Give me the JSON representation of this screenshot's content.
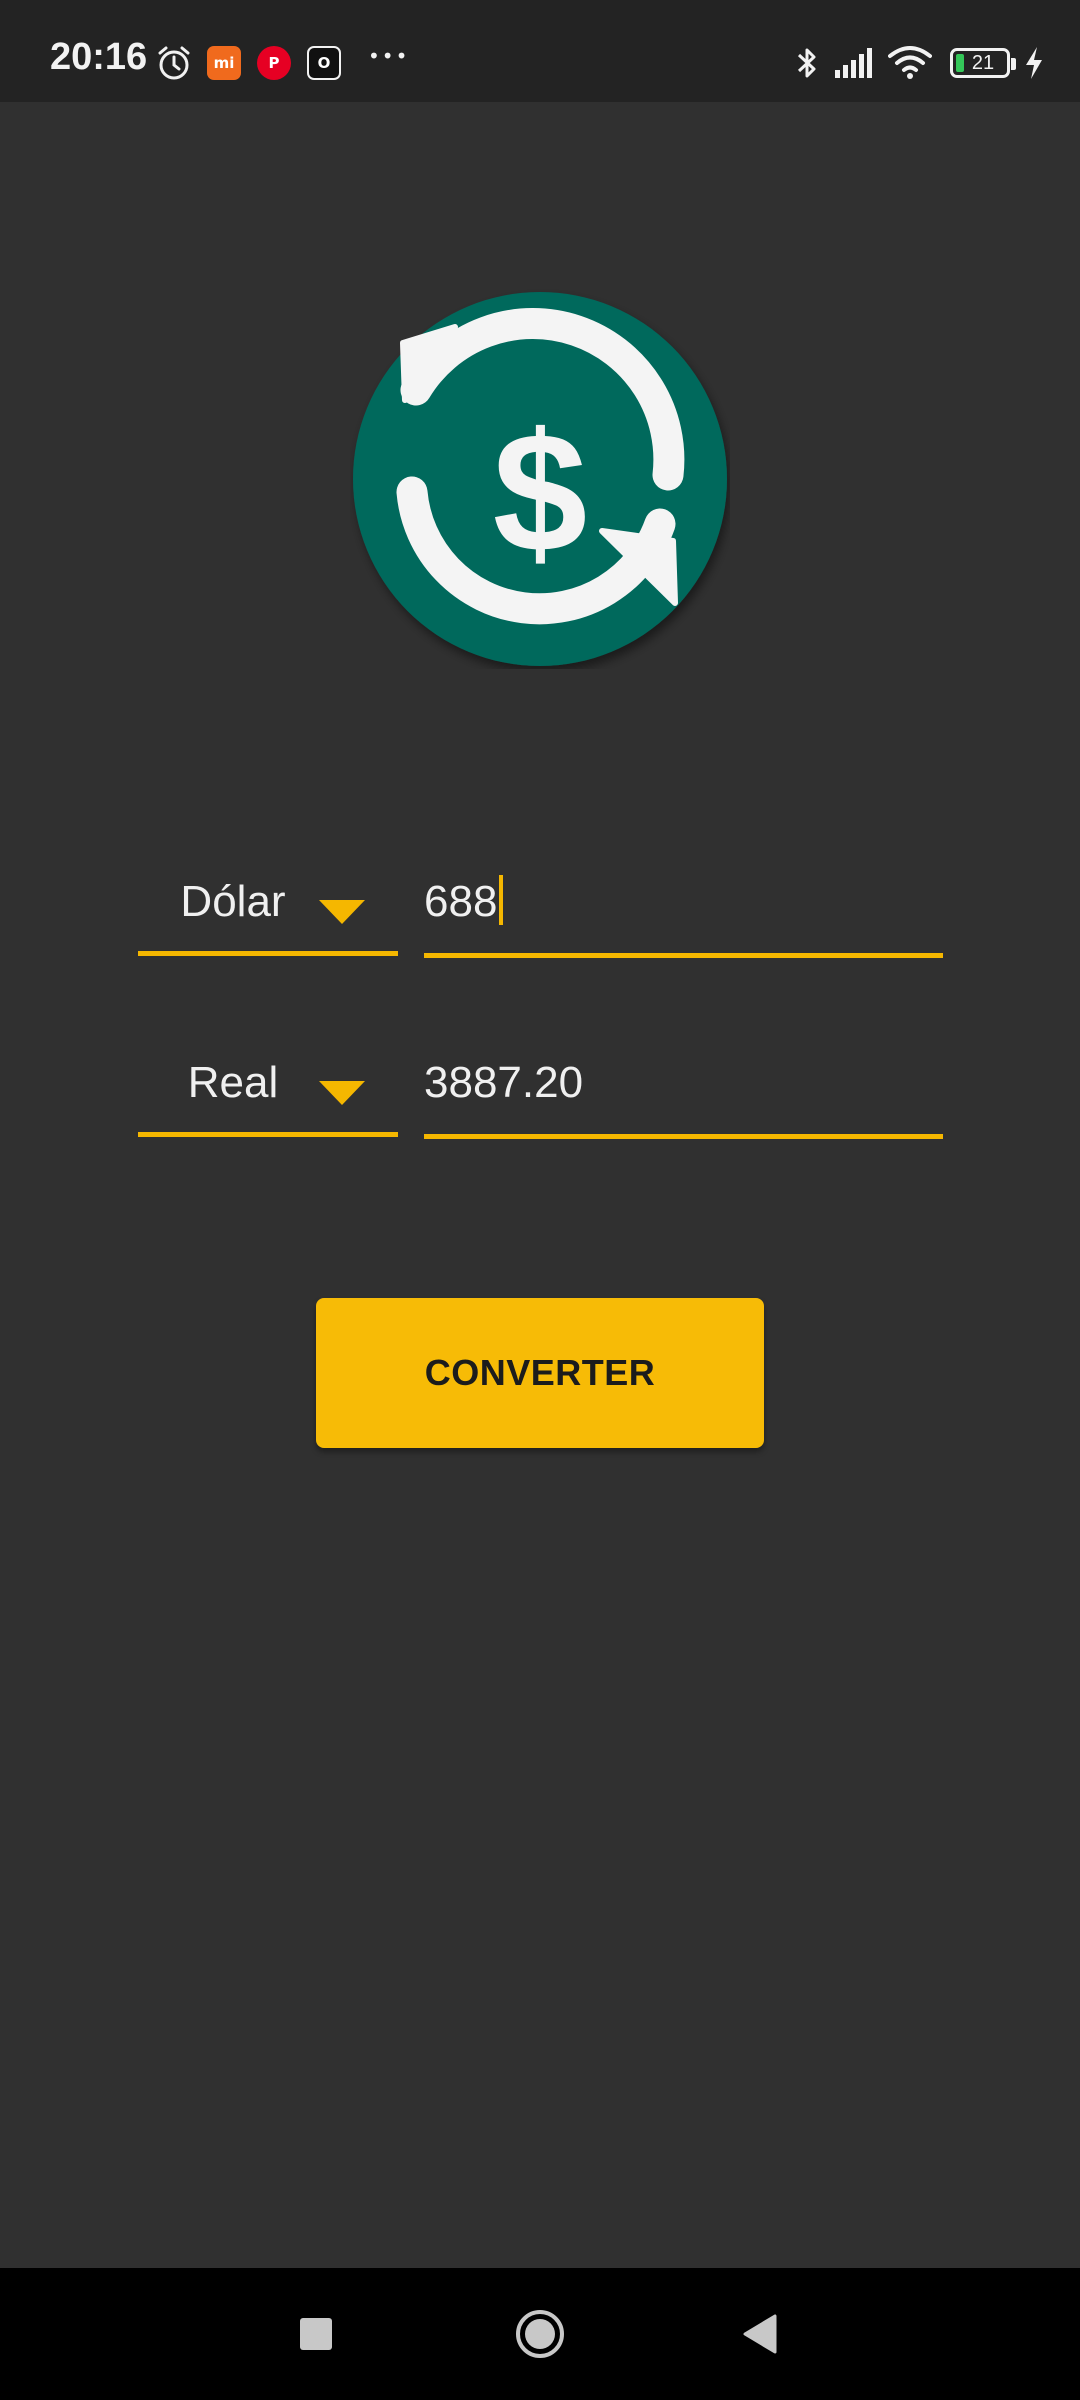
{
  "status_bar": {
    "time": "20:16",
    "battery_level": "21",
    "notification_apps": [
      {
        "name": "mi",
        "label": "mi",
        "color": "#f06a1d"
      },
      {
        "name": "pinterest",
        "label": "P",
        "color": "#e60023"
      },
      {
        "name": "o-app",
        "label": "O",
        "color": "#111111"
      }
    ],
    "overflow_dots": "•••"
  },
  "logo": {
    "icon": "currency-exchange-icon",
    "background_color": "#00695c",
    "symbol": "$"
  },
  "converter": {
    "from": {
      "currency": "Dólar",
      "amount": "688"
    },
    "to": {
      "currency": "Real",
      "amount": "3887.20"
    }
  },
  "actions": {
    "convert_label": "CONVERTER"
  },
  "colors": {
    "accent": "#f5b700",
    "button": "#f7bb06",
    "background": "#303030",
    "status_bar": "#232323"
  }
}
